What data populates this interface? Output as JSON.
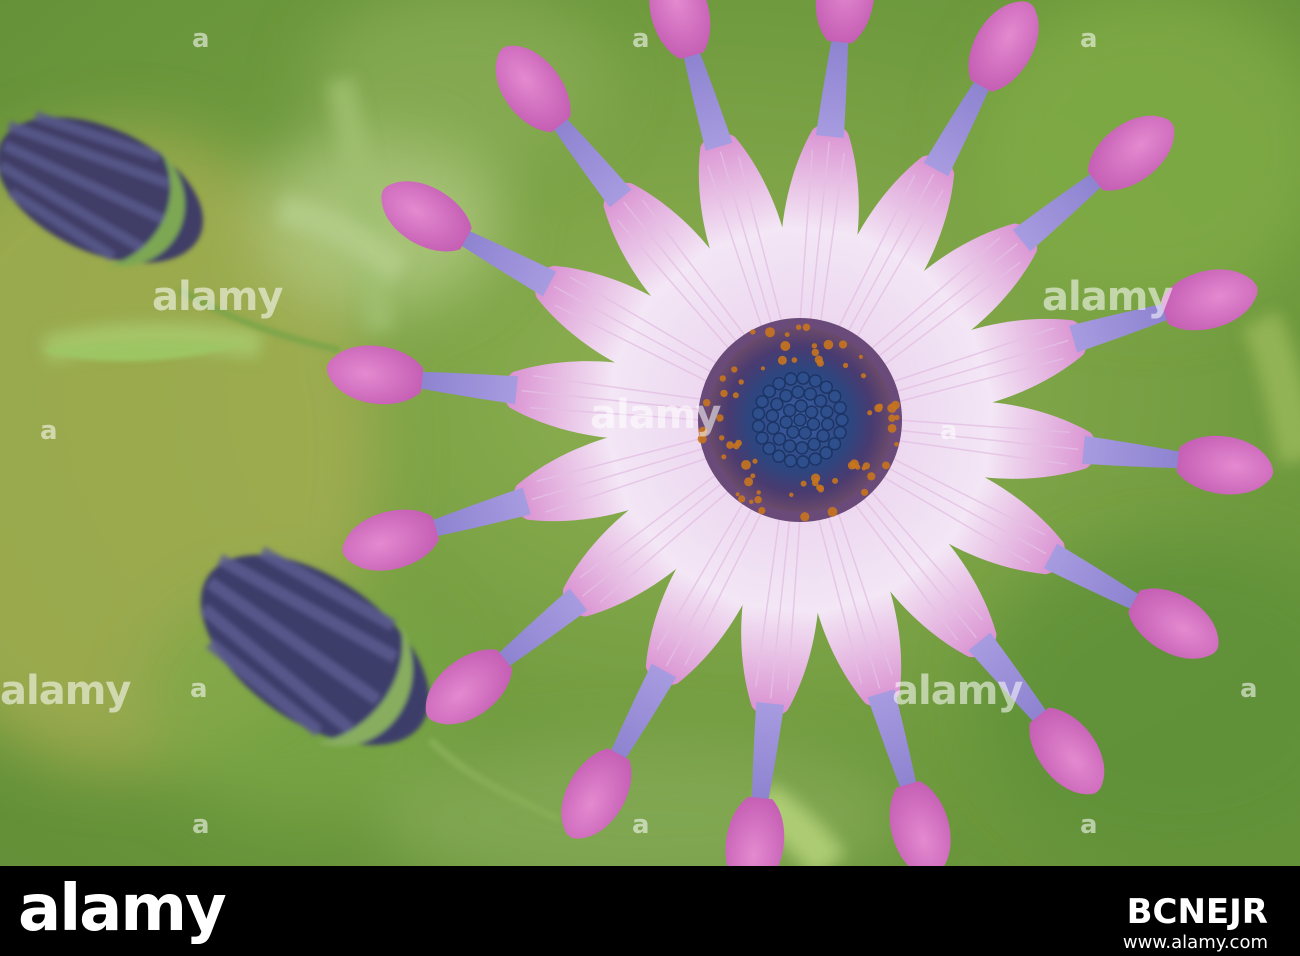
{
  "photo": {
    "subject": "Purple spoon-petal osteospermum flower with two dark buds",
    "colors": {
      "background_green": "#6f9a3e",
      "background_light": "#9ab85c",
      "petal_pink": "#d77ec8",
      "petal_white": "#f6eef7",
      "petal_lavender": "#9c8fd8",
      "center_blue": "#2f4f8c",
      "pollen_orange": "#c8741e",
      "bud_dark": "#3e3d6a"
    }
  },
  "watermark": {
    "text": "alamy",
    "letter": "a"
  },
  "footer": {
    "logo": "alamy",
    "image_id": "BCNEJR",
    "url": "www.alamy.com"
  }
}
